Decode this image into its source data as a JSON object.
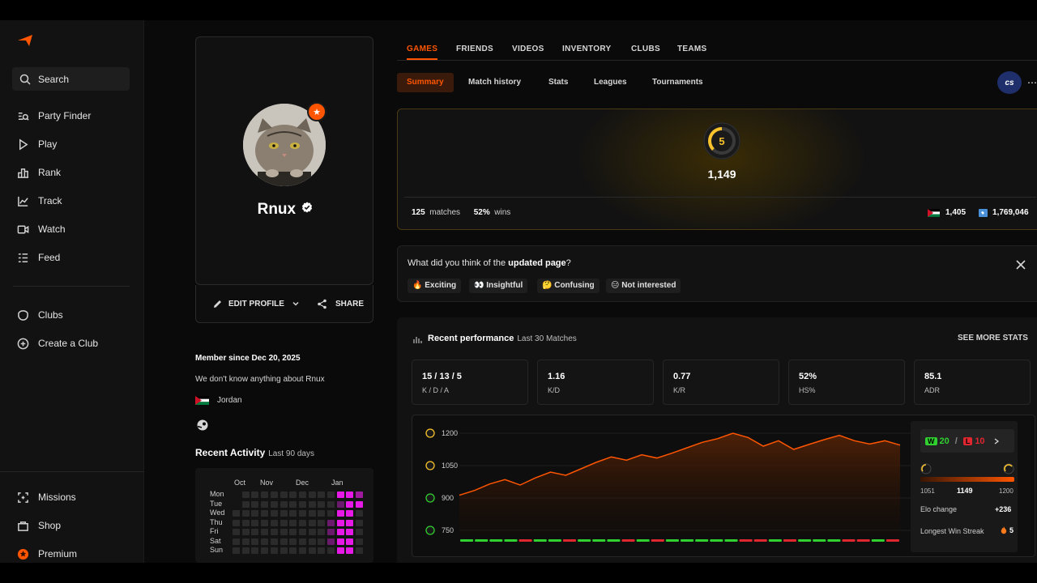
{
  "sidebar": {
    "search": "Search",
    "items": [
      {
        "label": "Party Finder",
        "icon": "party-finder-icon"
      },
      {
        "label": "Play",
        "icon": "play-icon"
      },
      {
        "label": "Rank",
        "icon": "rank-icon"
      },
      {
        "label": "Track",
        "icon": "track-icon"
      },
      {
        "label": "Watch",
        "icon": "watch-icon"
      },
      {
        "label": "Feed",
        "icon": "feed-icon"
      }
    ],
    "clubs": [
      {
        "label": "Clubs",
        "icon": "clubs-icon"
      },
      {
        "label": "Create a Club",
        "icon": "create-club-icon"
      }
    ],
    "bottom": [
      {
        "label": "Missions",
        "icon": "missions-icon"
      },
      {
        "label": "Shop",
        "icon": "shop-icon"
      },
      {
        "label": "Premium",
        "icon": "premium-icon"
      }
    ]
  },
  "profile": {
    "username": "Rnux",
    "edit_label": "EDIT PROFILE",
    "share_label": "SHARE",
    "member_since": "Member since Dec 20, 2025",
    "bio": "We don't know anything about Rnux",
    "country": "Jordan"
  },
  "activity": {
    "title": "Recent Activity",
    "subtitle": "Last 90 days",
    "months": [
      "Oct",
      "Nov",
      "Dec",
      "Jan"
    ],
    "days": [
      "Mon",
      "Tue",
      "Wed",
      "Thu",
      "Fri",
      "Sat",
      "Sun"
    ]
  },
  "tabs": [
    "GAMES",
    "FRIENDS",
    "VIDEOS",
    "INVENTORY",
    "CLUBS",
    "TEAMS"
  ],
  "subtabs": [
    "Summary",
    "Match history",
    "Stats",
    "Leagues",
    "Tournaments"
  ],
  "game_badge": "cs",
  "elo": {
    "level": "5",
    "value": "1,149",
    "matches": "125",
    "matches_label": "matches",
    "wins": "52%",
    "wins_label": "wins",
    "country_rank": "1,405",
    "world_rank": "1,769,046"
  },
  "survey": {
    "question_prefix": "What did you think of the ",
    "question_bold": "updated page",
    "question_suffix": "?",
    "options": [
      "🔥 Exciting",
      "👀 Insightful",
      "🤔 Confusing",
      "😑 Not interested"
    ]
  },
  "performance": {
    "title": "Recent performance",
    "subtitle": "Last 30 Matches",
    "see_more": "SEE MORE STATS",
    "stats": [
      {
        "value": "15 / 13 / 5",
        "label": "K / D / A"
      },
      {
        "value": "1.16",
        "label": "K/D"
      },
      {
        "value": "0.77",
        "label": "K/R"
      },
      {
        "value": "52%",
        "label": "HS%"
      },
      {
        "value": "85.1",
        "label": "ADR"
      }
    ],
    "wins": "20",
    "losses": "10",
    "w_letter": "W",
    "l_letter": "L",
    "slash": "/",
    "range_min": "1051",
    "range_cur": "1149",
    "range_max": "1200",
    "elo_change_label": "Elo change",
    "elo_change": "+236",
    "streak_label": "Longest Win Streak",
    "streak": "5"
  },
  "chart_data": {
    "type": "area",
    "title": "",
    "xlabel": "",
    "ylabel": "",
    "yticks": [
      "1200",
      "1050",
      "900",
      "750"
    ],
    "ylim": [
      720,
      1230
    ],
    "values": [
      913,
      935,
      965,
      985,
      960,
      993,
      1020,
      1005,
      1035,
      1065,
      1090,
      1075,
      1100,
      1085,
      1108,
      1133,
      1158,
      1175,
      1200,
      1180,
      1140,
      1165,
      1125,
      1148,
      1170,
      1190,
      1165,
      1150,
      1165,
      1145
    ],
    "results": [
      "W",
      "W",
      "W",
      "W",
      "L",
      "W",
      "W",
      "L",
      "W",
      "W",
      "W",
      "L",
      "W",
      "L",
      "W",
      "W",
      "W",
      "W",
      "W",
      "L",
      "L",
      "W",
      "L",
      "W",
      "W",
      "W",
      "L",
      "L",
      "W",
      "L"
    ],
    "colors": {
      "line": "#ff5500",
      "win": "#2fd02f",
      "loss": "#e0262e",
      "accent": "#ff5500"
    }
  }
}
